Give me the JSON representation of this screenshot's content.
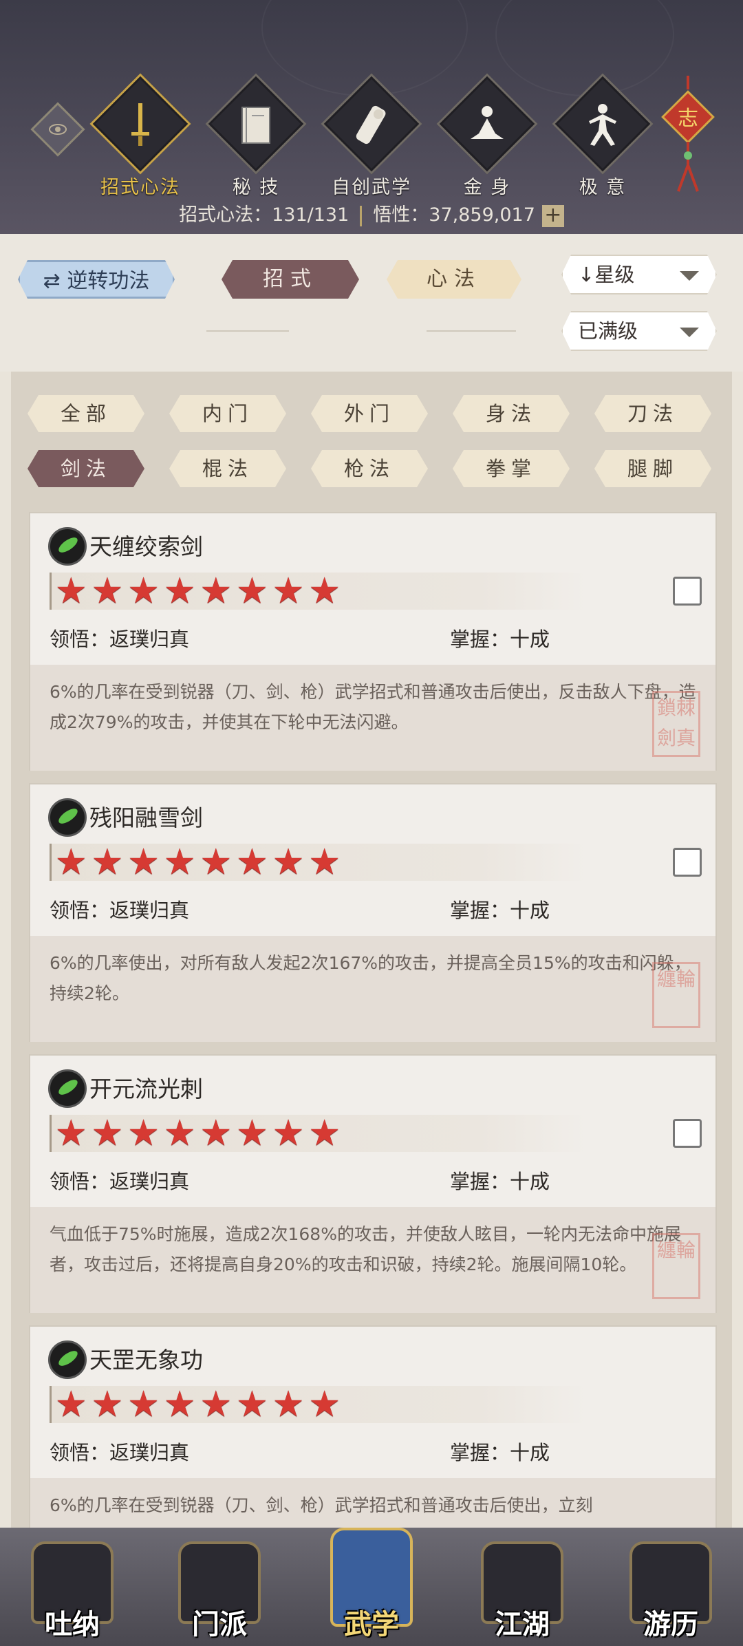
{
  "header": {
    "tabs": [
      {
        "label": "招式心法",
        "icon": "sword-icon",
        "active": true
      },
      {
        "label": "秘 技",
        "icon": "book-icon",
        "active": false
      },
      {
        "label": "自创武学",
        "icon": "scroll-icon",
        "active": false
      },
      {
        "label": "金 身",
        "icon": "meditate-icon",
        "active": false
      },
      {
        "label": "极 意",
        "icon": "martial-pose-icon",
        "active": false
      }
    ],
    "knot_char": "志",
    "stats_label": "招式心法：131/131",
    "wuxing_label": "悟性：37,859,017",
    "plus": "+"
  },
  "toolbar": {
    "reverse_label": "逆转功法",
    "tab_zhaoshi": "招式",
    "tab_xinfa": "心法",
    "sort_label": "星级",
    "level_filter": "已满级"
  },
  "filters": [
    {
      "label": "全部",
      "active": false
    },
    {
      "label": "内门",
      "active": false
    },
    {
      "label": "外门",
      "active": false
    },
    {
      "label": "身法",
      "active": false
    },
    {
      "label": "刀法",
      "active": false
    },
    {
      "label": "剑法",
      "active": true
    },
    {
      "label": "棍法",
      "active": false
    },
    {
      "label": "枪法",
      "active": false
    },
    {
      "label": "拳掌",
      "active": false
    },
    {
      "label": "腿脚",
      "active": false
    }
  ],
  "skills": [
    {
      "name": "天缠绞索剑",
      "stars": "★★★★★★★★",
      "lingwu": "领悟：返璞归真",
      "zhangwo": "掌握：十成",
      "desc": "6%的几率在受到锐器（刀、剑、枪）武学招式和普通攻击后使出，反击敌人下盘，造成2次79%的攻击，并使其在下轮中无法闪避。",
      "seal": "鎖棘劍真"
    },
    {
      "name": "残阳融雪剑",
      "stars": "★★★★★★★★",
      "lingwu": "领悟：返璞归真",
      "zhangwo": "掌握：十成",
      "desc": "6%的几率使出，对所有敌人发起2次167%的攻击，并提高全员15%的攻击和闪躲，持续2轮。",
      "seal": "纏輪"
    },
    {
      "name": "开元流光刺",
      "stars": "★★★★★★★★",
      "lingwu": "领悟：返璞归真",
      "zhangwo": "掌握：十成",
      "desc": "气血低于75%时施展，造成2次168%的攻击，并使敌人眩目，一轮内无法命中施展者，攻击过后，还将提高自身20%的攻击和识破，持续2轮。施展间隔10轮。",
      "seal": "纏輪"
    },
    {
      "name": "天罡无象功",
      "stars": "★★★★★★★★",
      "lingwu": "领悟：返璞归真",
      "zhangwo": "掌握：十成",
      "desc": "6%的几率在受到锐器（刀、剑、枪）武学招式和普通攻击后使出，立刻",
      "seal": ""
    }
  ],
  "nav": [
    {
      "label": "吐纳",
      "active": false
    },
    {
      "label": "门派",
      "active": false
    },
    {
      "label": "武学",
      "active": true
    },
    {
      "label": "江湖",
      "active": false
    },
    {
      "label": "游历",
      "active": false
    }
  ]
}
